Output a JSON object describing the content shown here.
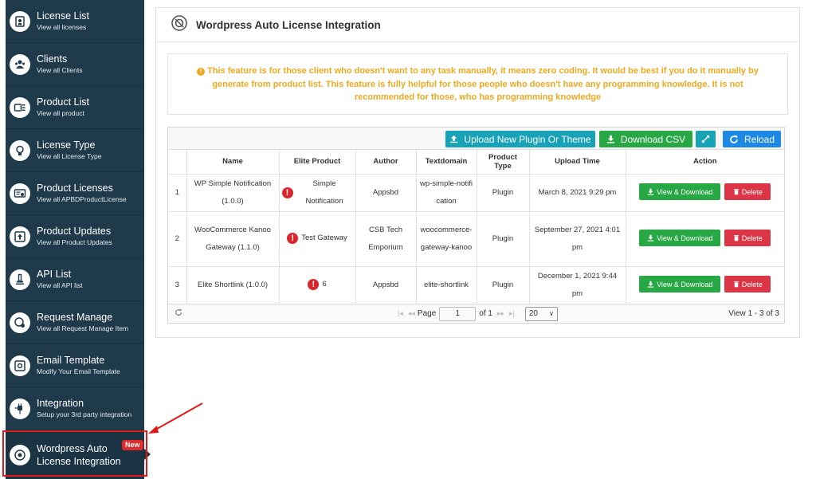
{
  "sidebar": {
    "items": [
      {
        "title": "License List",
        "subtitle": "View all licenses"
      },
      {
        "title": "Clients",
        "subtitle": "View all Clients"
      },
      {
        "title": "Product List",
        "subtitle": "View all product"
      },
      {
        "title": "License Type",
        "subtitle": "View all License Type"
      },
      {
        "title": "Product Licenses",
        "subtitle": "View all APBDProductLicense"
      },
      {
        "title": "Product Updates",
        "subtitle": "View all Product Updates"
      },
      {
        "title": "API List",
        "subtitle": "View all API list"
      },
      {
        "title": "Request Manage",
        "subtitle": "View all Request Manage Item"
      },
      {
        "title": "Email Template",
        "subtitle": "Modify Your Email Template"
      },
      {
        "title": "Integration",
        "subtitle": "Setup your 3rd party integration"
      }
    ],
    "active": {
      "title_line1": "Wordpress Auto",
      "title_line2": "License Integration",
      "badge": "New"
    }
  },
  "page": {
    "title": "Wordpress Auto License Integration",
    "notice": "This feature is for those client who doesn't want to any task manually, it means zero coding. It would be best if you do it manually by generate from product list. This feature is fully helpful for those people who doesn't have any programming knowledge. It is not recommended for those, who has programming knowledge"
  },
  "toolbar": {
    "upload_label": "Upload New Plugin Or Theme",
    "download_csv_label": "Download CSV",
    "reload_label": "Reload"
  },
  "table": {
    "headers": [
      "",
      "Name",
      "Elite Product",
      "Author",
      "Textdomain",
      "Product Type",
      "Upload Time",
      "Action"
    ],
    "rows": [
      {
        "num": "1",
        "name": "WP Simple Notification (1.0.0)",
        "elite": "Simple Notification",
        "author": "Appsbd",
        "textdomain": "wp-simple-notification",
        "type": "Plugin",
        "time": "March 8, 2021 9:29 pm"
      },
      {
        "num": "2",
        "name": "WooCommerce Kanoo Gateway (1.1.0)",
        "elite": "Test Gateway",
        "author": "CSB Tech Emporium",
        "textdomain": "woocommerce-gateway-kanoo",
        "type": "Plugin",
        "time": "September 27, 2021 4:01 pm"
      },
      {
        "num": "3",
        "name": "Elite Shortlink (1.0.0)",
        "elite": "6",
        "author": "Appsbd",
        "textdomain": "elite-shortlink",
        "type": "Plugin",
        "time": "December 1, 2021 9:44 pm"
      }
    ],
    "view_download_label": "View & Download",
    "delete_label": "Delete"
  },
  "pager": {
    "page_label": "Page",
    "page_value": "1",
    "of_label": "of 1",
    "page_size": "20",
    "view_info": "View 1 - 3 of 3"
  },
  "colors": {
    "sidebar_bg": "#1f3a4a",
    "notice_text": "#f0a91f",
    "primary_green": "#28a745",
    "teal": "#17a2b8",
    "danger": "#dc3545",
    "highlight": "#e01818"
  }
}
